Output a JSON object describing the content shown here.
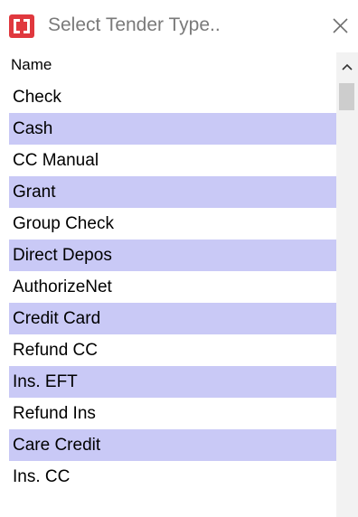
{
  "dialog": {
    "title_placeholder": "Select Tender Type..",
    "app_icon": "tender-app-icon",
    "close_icon": "close-icon",
    "accent_color": "#e0383e"
  },
  "list": {
    "column_header": "Name",
    "highlight_color": "#c9c9f6",
    "items": [
      {
        "label": "Check",
        "alt": false
      },
      {
        "label": "Cash",
        "alt": true
      },
      {
        "label": "CC Manual",
        "alt": false
      },
      {
        "label": "Grant",
        "alt": true
      },
      {
        "label": "Group Check",
        "alt": false
      },
      {
        "label": "Direct Depos",
        "alt": true
      },
      {
        "label": "AuthorizeNet",
        "alt": false
      },
      {
        "label": "Credit Card",
        "alt": true
      },
      {
        "label": "Refund CC",
        "alt": false
      },
      {
        "label": "Ins. EFT",
        "alt": true
      },
      {
        "label": "Refund Ins",
        "alt": false
      },
      {
        "label": "Care Credit",
        "alt": true
      },
      {
        "label": "Ins. CC",
        "alt": false
      }
    ]
  },
  "scrollbar": {
    "up_icon": "chevron-up-icon"
  }
}
